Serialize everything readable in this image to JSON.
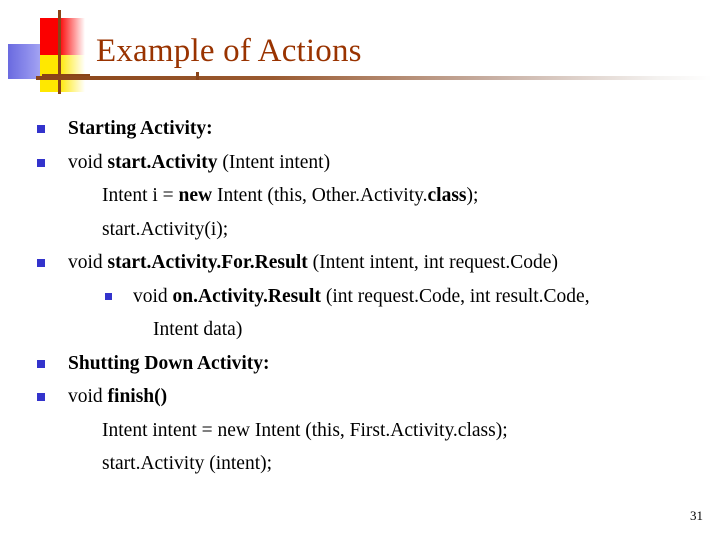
{
  "slide": {
    "title": "Example of Actions",
    "page_number": "31",
    "title_color": "#993300",
    "bullet_color": "#3333CC",
    "body_text_color": "#000000",
    "background_color": "#FFFFFF",
    "rule_color": "#8A4418",
    "logo_colors": {
      "red": "#FB0000",
      "yellow": "#FFE800",
      "blue": "#6A6AE0",
      "bar": "#8A4418"
    }
  },
  "content": {
    "lines": [
      {
        "id": "starting-activity-heading",
        "level": 1,
        "bullet": true,
        "runs": [
          {
            "text": "Starting Activity:",
            "bold": true
          }
        ]
      },
      {
        "id": "start-activity-signature",
        "level": 1,
        "bullet": true,
        "runs": [
          {
            "text": "void  ",
            "bold": false
          },
          {
            "text": "start.Activity",
            "bold": true
          },
          {
            "text": "  (Intent  intent)",
            "bold": false
          }
        ]
      },
      {
        "id": "intent-new-other-activity",
        "level": 2,
        "bullet": false,
        "runs": [
          {
            "text": "Intent i =  ",
            "bold": false
          },
          {
            "text": "new",
            "bold": true
          },
          {
            "text": "  Intent (this, Other.Activity.",
            "bold": false
          },
          {
            "text": "class",
            "bold": true
          },
          {
            "text": ");",
            "bold": false
          }
        ]
      },
      {
        "id": "start-activity-call",
        "level": 2,
        "bullet": false,
        "runs": [
          {
            "text": "start.Activity(i);",
            "bold": false
          }
        ]
      },
      {
        "id": "start-activity-for-result-signature",
        "level": 1,
        "bullet": true,
        "runs": [
          {
            "text": "void  ",
            "bold": false
          },
          {
            "text": "start.Activity.For.Result",
            "bold": true
          },
          {
            "text": "  (Intent  intent, int request.Code)",
            "bold": false
          }
        ]
      },
      {
        "id": "on-activity-result-signature",
        "level": 3,
        "bullet": true,
        "runs": [
          {
            "text": "void  ",
            "bold": false
          },
          {
            "text": "on.Activity.Result",
            "bold": true
          },
          {
            "text": "  (int request.Code, int result.Code,",
            "bold": false
          }
        ]
      },
      {
        "id": "on-activity-result-continuation",
        "level": 4,
        "bullet": false,
        "runs": [
          {
            "text": "Intent  data)",
            "bold": false
          }
        ]
      },
      {
        "id": "shutting-down-activity-heading",
        "level": 1,
        "bullet": true,
        "runs": [
          {
            "text": "Shutting Down Activity:",
            "bold": true
          }
        ]
      },
      {
        "id": "finish-signature",
        "level": 1,
        "bullet": true,
        "runs": [
          {
            "text": "void  ",
            "bold": false
          },
          {
            "text": "finish()",
            "bold": true
          }
        ]
      },
      {
        "id": "intent-new-first-activity",
        "level": 2,
        "bullet": false,
        "runs": [
          {
            "text": "Intent  intent =  new  Intent (this, First.Activity.class);",
            "bold": false
          }
        ]
      },
      {
        "id": "start-activity-intent-call",
        "level": 2,
        "bullet": false,
        "runs": [
          {
            "text": "start.Activity (intent);",
            "bold": false
          }
        ]
      }
    ]
  }
}
